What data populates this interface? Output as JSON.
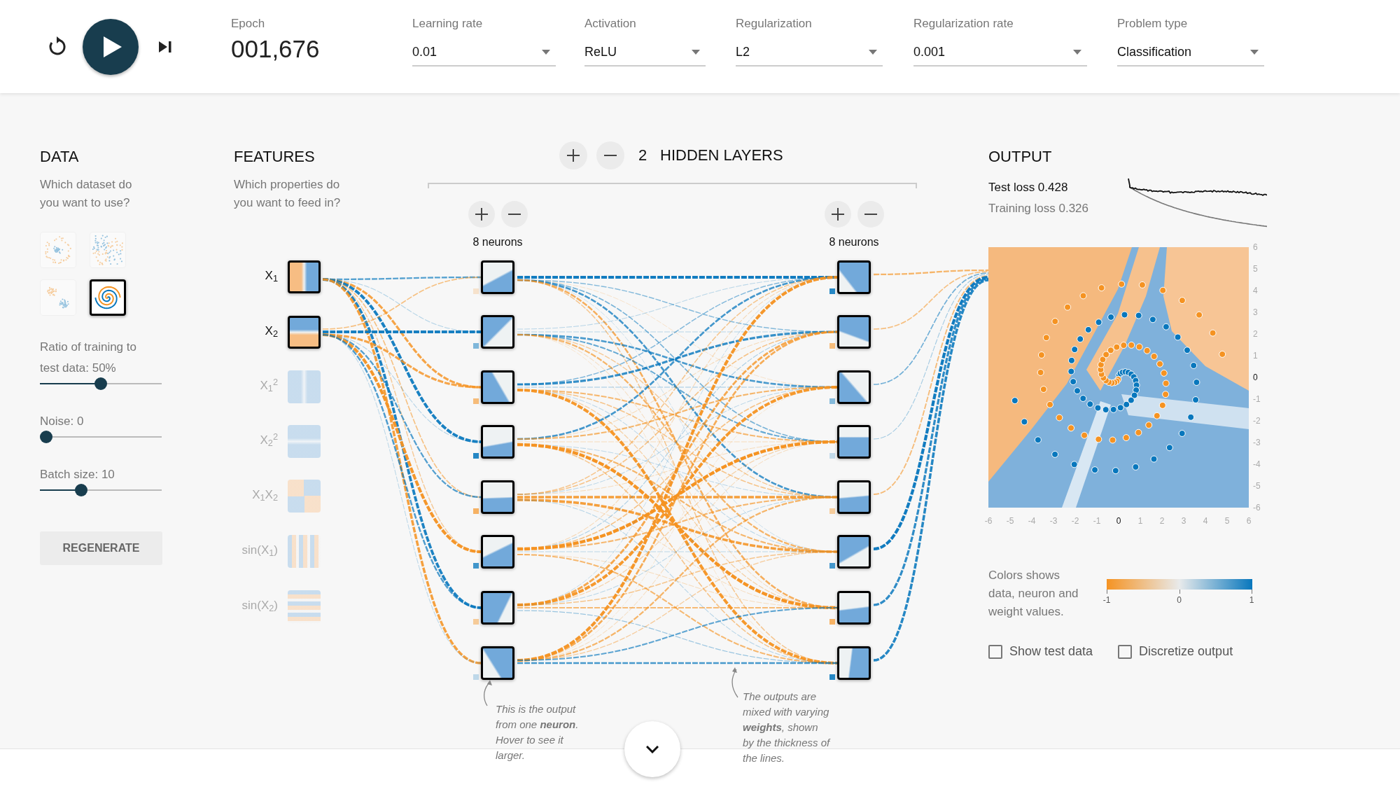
{
  "epoch": {
    "label": "Epoch",
    "value": "001,676"
  },
  "dropdowns": [
    {
      "label": "Learning rate",
      "value": "0.01"
    },
    {
      "label": "Activation",
      "value": "ReLU"
    },
    {
      "label": "Regularization",
      "value": "L2"
    },
    {
      "label": "Regularization rate",
      "value": "0.001"
    },
    {
      "label": "Problem type",
      "value": "Classification"
    }
  ],
  "data": {
    "title": "DATA",
    "description": "Which dataset do you want to use?",
    "datasets": [
      {
        "kind": "circle",
        "selected": false
      },
      {
        "kind": "xor",
        "selected": false
      },
      {
        "kind": "gaussian",
        "selected": false
      },
      {
        "kind": "spiral",
        "selected": true
      }
    ],
    "sliders": [
      {
        "label": "Ratio of training to test data:",
        "value": "50%",
        "level": 0.5
      },
      {
        "label": "Noise:",
        "value": "0",
        "level": 0
      },
      {
        "label": "Batch size:",
        "value": "10",
        "level": 0.32
      }
    ],
    "button": "REGENERATE"
  },
  "features": {
    "title": "FEATURES",
    "description": "Which properties do you want to feed in?",
    "items": [
      {
        "label": "X$_{1}$",
        "enabled": true
      },
      {
        "label": "X$_{2}$",
        "enabled": true
      },
      {
        "label": "X$_{1}$$^{2}$",
        "enabled": false
      },
      {
        "label": "X$_{2}$$^{2}$",
        "enabled": false
      },
      {
        "label": "X$_{1}$X$_{2}$",
        "enabled": false
      },
      {
        "label": "sin(X$_{1}$)",
        "enabled": false
      },
      {
        "label": "sin(X$_{2}$)",
        "enabled": false
      }
    ]
  },
  "hidden_layers": {
    "count": "2",
    "title": "HIDDEN LAYERS",
    "layers": [
      {
        "neurons": "8 neurons"
      },
      {
        "neurons": "8 neurons"
      }
    ]
  },
  "output": {
    "title": "OUTPUT",
    "test_loss": "Test loss 0.428",
    "training_loss": "Training loss 0.326",
    "y_ticks": [
      {
        "label": "6",
        "emphasized": false
      },
      {
        "label": "5",
        "emphasized": false
      },
      {
        "label": "4",
        "emphasized": false
      },
      {
        "label": "3",
        "emphasized": false
      },
      {
        "label": "2",
        "emphasized": false
      },
      {
        "label": "1",
        "emphasized": false
      },
      {
        "label": "0",
        "emphasized": true
      },
      {
        "label": "-1",
        "emphasized": false
      },
      {
        "label": "-2",
        "emphasized": false
      },
      {
        "label": "-3",
        "emphasized": false
      },
      {
        "label": "-4",
        "emphasized": false
      },
      {
        "label": "-5",
        "emphasized": false
      },
      {
        "label": "-6",
        "emphasized": false
      }
    ],
    "x_ticks": [
      {
        "label": "-6",
        "emphasized": false
      },
      {
        "label": "-5",
        "emphasized": false
      },
      {
        "label": "-4",
        "emphasized": false
      },
      {
        "label": "-3",
        "emphasized": false
      },
      {
        "label": "-2",
        "emphasized": false
      },
      {
        "label": "-1",
        "emphasized": false
      },
      {
        "label": "0",
        "emphasized": true
      },
      {
        "label": "1",
        "emphasized": false
      },
      {
        "label": "2",
        "emphasized": false
      },
      {
        "label": "3",
        "emphasized": false
      },
      {
        "label": "4",
        "emphasized": false
      },
      {
        "label": "5",
        "emphasized": false
      },
      {
        "label": "6",
        "emphasized": false
      }
    ],
    "legend": {
      "text": "Colors shows data, neuron and weight values.",
      "scale_ticks": [
        "-1",
        "0",
        "1"
      ]
    },
    "checkboxes": [
      {
        "label": "Show test data",
        "checked": false
      },
      {
        "label": "Discretize output",
        "checked": false
      }
    ]
  },
  "annotations": [
    {
      "text": "This is the output from one **neuron**. Hover to see it larger."
    },
    {
      "text": "The outputs are mixed with varying **weights**, shown by the thickness of the lines."
    }
  ]
}
